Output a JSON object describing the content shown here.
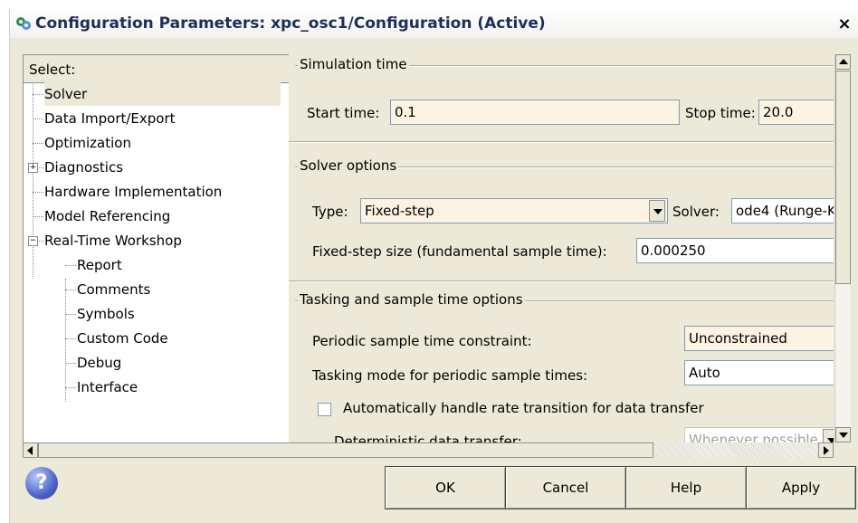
{
  "window": {
    "title": "Configuration Parameters: xpc_osc1/Configuration (Active)",
    "close_glyph": "×",
    "app_icon": "simulink-config-icon"
  },
  "select_panel": {
    "header": "Select:",
    "items": [
      {
        "label": "Solver",
        "selected": true
      },
      {
        "label": "Data Import/Export"
      },
      {
        "label": "Optimization"
      },
      {
        "label": "Diagnostics",
        "expander": "+"
      },
      {
        "label": "Hardware Implementation"
      },
      {
        "label": "Model Referencing"
      },
      {
        "label": "Real-Time Workshop",
        "expander": "−"
      },
      {
        "label": "Report"
      },
      {
        "label": "Comments"
      },
      {
        "label": "Symbols"
      },
      {
        "label": "Custom Code"
      },
      {
        "label": "Debug"
      },
      {
        "label": "Interface"
      }
    ]
  },
  "simulation_time": {
    "group_label": "Simulation time",
    "start_label": "Start time:",
    "start_value": "0.1",
    "stop_label": "Stop time:",
    "stop_value": "20.0"
  },
  "solver_options": {
    "group_label": "Solver options",
    "type_label": "Type:",
    "type_value": "Fixed-step",
    "solver_label": "Solver:",
    "solver_value": "ode4 (Runge-K",
    "step_label": "Fixed-step size (fundamental sample time):",
    "step_value": "0.000250"
  },
  "tasking": {
    "group_label": "Tasking and sample time options",
    "periodic_label": "Periodic sample time constraint:",
    "periodic_value": "Unconstrained",
    "mode_label": "Tasking mode for periodic sample times:",
    "mode_value": "Auto",
    "auto_rate_label": "Automatically handle rate transition for data transfer",
    "auto_rate_checked": false,
    "deterministic_label": "Deterministic data transfer:",
    "deterministic_value": "Whenever possible"
  },
  "buttons": {
    "help_glyph": "?",
    "ok": "OK",
    "cancel": "Cancel",
    "help": "Help",
    "apply": "Apply"
  },
  "colors": {
    "dialog_bg": "#ece9d8",
    "field_bg": "#fdf3e2",
    "title_text": "#1b2f5a"
  }
}
